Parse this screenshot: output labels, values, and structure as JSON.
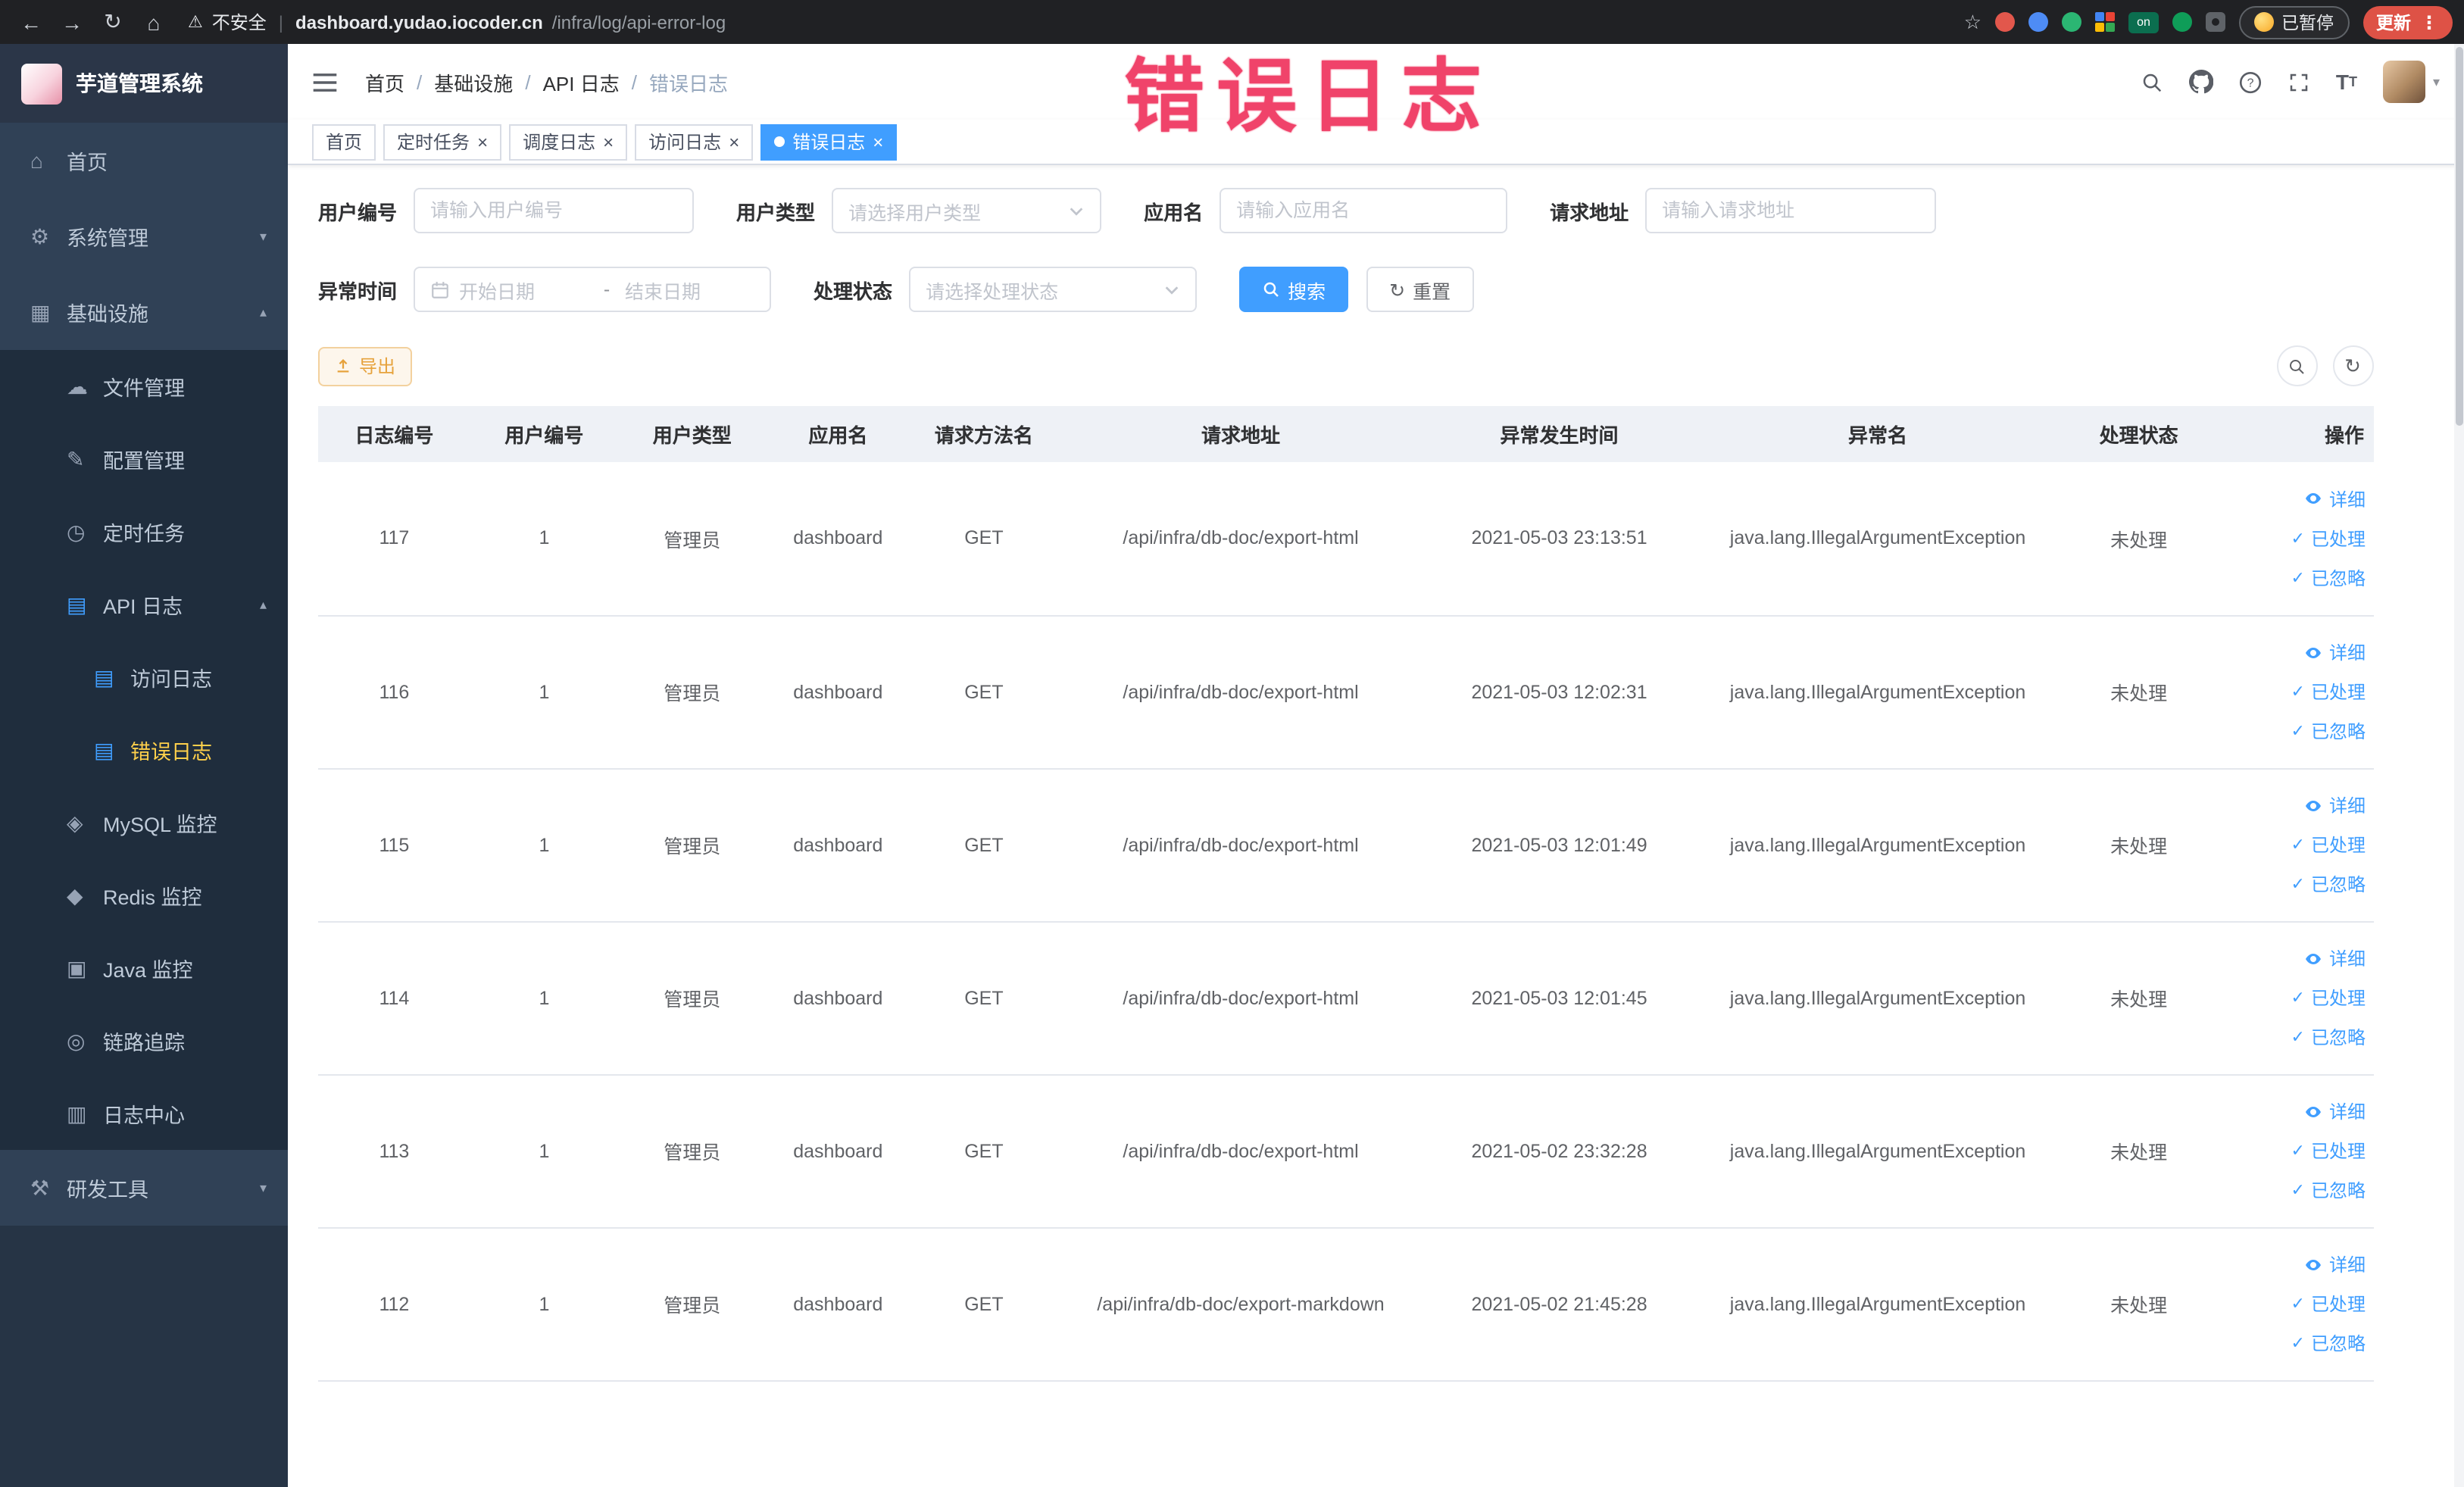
{
  "browser": {
    "security_label": "不安全",
    "url_host": "dashboard.yudao.iocoder.cn",
    "url_path": "/infra/log/api-error-log",
    "extension_on_badge": "on",
    "paused_badge": "已暂停",
    "update_button": "更新"
  },
  "annotation": "错误日志",
  "sidebar": {
    "logo_title": "芋道管理系统",
    "items": [
      {
        "label": "首页",
        "icon": "home-icon",
        "level": 1
      },
      {
        "label": "系统管理",
        "icon": "gear-icon",
        "level": 1,
        "chevron": "down"
      },
      {
        "label": "基础设施",
        "icon": "infrastructure-icon",
        "level": 1,
        "chevron": "up"
      },
      {
        "label": "文件管理",
        "icon": "file-icon",
        "level": 2
      },
      {
        "label": "配置管理",
        "icon": "config-icon",
        "level": 2
      },
      {
        "label": "定时任务",
        "icon": "timer-icon",
        "level": 2
      },
      {
        "label": "API 日志",
        "icon": "api-log-icon",
        "level": 2,
        "chevron": "up"
      },
      {
        "label": "访问日志",
        "icon": "access-log-icon",
        "level": 3
      },
      {
        "label": "错误日志",
        "icon": "error-log-icon",
        "level": 3,
        "active": true
      },
      {
        "label": "MySQL 监控",
        "icon": "mysql-icon",
        "level": 2
      },
      {
        "label": "Redis 监控",
        "icon": "redis-icon",
        "level": 2
      },
      {
        "label": "Java 监控",
        "icon": "java-icon",
        "level": 2
      },
      {
        "label": "链路追踪",
        "icon": "trace-icon",
        "level": 2
      },
      {
        "label": "日志中心",
        "icon": "log-center-icon",
        "level": 2
      },
      {
        "label": "研发工具",
        "icon": "devtools-icon",
        "level": 1,
        "chevron": "down"
      }
    ],
    "icon_glyphs": {
      "home-icon": "⌂",
      "gear-icon": "⚙",
      "infrastructure-icon": "▦",
      "file-icon": "☁",
      "config-icon": "✎",
      "timer-icon": "◷",
      "api-log-icon": "▤",
      "access-log-icon": "▤",
      "error-log-icon": "▤",
      "mysql-icon": "◈",
      "redis-icon": "◆",
      "java-icon": "▣",
      "trace-icon": "◎",
      "log-center-icon": "▥",
      "devtools-icon": "⚒"
    }
  },
  "header": {
    "breadcrumb": [
      "首页",
      "基础设施",
      "API 日志",
      "错误日志"
    ]
  },
  "tabs": [
    {
      "label": "首页",
      "closable": false,
      "active": false
    },
    {
      "label": "定时任务",
      "closable": true,
      "active": false
    },
    {
      "label": "调度日志",
      "closable": true,
      "active": false
    },
    {
      "label": "访问日志",
      "closable": true,
      "active": false
    },
    {
      "label": "错误日志",
      "closable": true,
      "active": true
    }
  ],
  "filters": {
    "user_id_label": "用户编号",
    "user_id_placeholder": "请输入用户编号",
    "user_type_label": "用户类型",
    "user_type_placeholder": "请选择用户类型",
    "app_name_label": "应用名",
    "app_name_placeholder": "请输入应用名",
    "request_url_label": "请求地址",
    "request_url_placeholder": "请输入请求地址",
    "exception_time_label": "异常时间",
    "start_date_placeholder": "开始日期",
    "range_separator": "-",
    "end_date_placeholder": "结束日期",
    "process_status_label": "处理状态",
    "process_status_placeholder": "请选择处理状态",
    "search_button": "搜索",
    "reset_button": "重置",
    "export_button": "导出"
  },
  "table": {
    "columns": [
      "日志编号",
      "用户编号",
      "用户类型",
      "应用名",
      "请求方法名",
      "请求地址",
      "异常发生时间",
      "异常名",
      "处理状态",
      "操作"
    ],
    "action_labels": {
      "detail": "详细",
      "processed": "已处理",
      "ignored": "已忽略"
    },
    "rows": [
      {
        "id": "117",
        "user_id": "1",
        "user_type": "管理员",
        "app": "dashboard",
        "method": "GET",
        "url": "/api/infra/db-doc/export-html",
        "time": "2021-05-03 23:13:51",
        "exception": "java.lang.IllegalArgumentException",
        "status": "未处理"
      },
      {
        "id": "116",
        "user_id": "1",
        "user_type": "管理员",
        "app": "dashboard",
        "method": "GET",
        "url": "/api/infra/db-doc/export-html",
        "time": "2021-05-03 12:02:31",
        "exception": "java.lang.IllegalArgumentException",
        "status": "未处理"
      },
      {
        "id": "115",
        "user_id": "1",
        "user_type": "管理员",
        "app": "dashboard",
        "method": "GET",
        "url": "/api/infra/db-doc/export-html",
        "time": "2021-05-03 12:01:49",
        "exception": "java.lang.IllegalArgumentException",
        "status": "未处理"
      },
      {
        "id": "114",
        "user_id": "1",
        "user_type": "管理员",
        "app": "dashboard",
        "method": "GET",
        "url": "/api/infra/db-doc/export-html",
        "time": "2021-05-03 12:01:45",
        "exception": "java.lang.IllegalArgumentException",
        "status": "未处理"
      },
      {
        "id": "113",
        "user_id": "1",
        "user_type": "管理员",
        "app": "dashboard",
        "method": "GET",
        "url": "/api/infra/db-doc/export-html",
        "time": "2021-05-02 23:32:28",
        "exception": "java.lang.IllegalArgumentException",
        "status": "未处理"
      },
      {
        "id": "112",
        "user_id": "1",
        "user_type": "管理员",
        "app": "dashboard",
        "method": "GET",
        "url": "/api/infra/db-doc/export-markdown",
        "time": "2021-05-02 21:45:28",
        "exception": "java.lang.IllegalArgumentException",
        "status": "未处理"
      }
    ]
  }
}
